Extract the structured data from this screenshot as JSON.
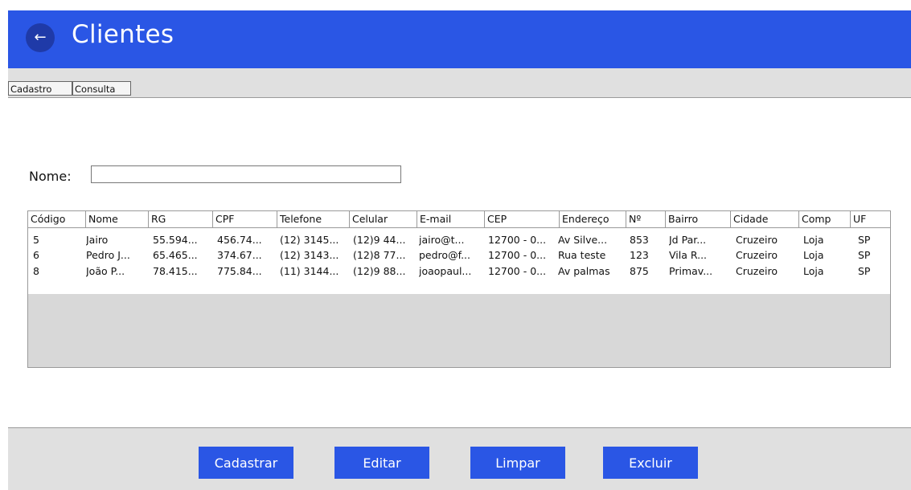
{
  "header": {
    "title": "Clientes",
    "back_icon": "arrow-left-icon",
    "color": "#2a56e5"
  },
  "tabs": [
    {
      "label": "Cadastro"
    },
    {
      "label": "Consulta"
    }
  ],
  "search": {
    "label": "Nome:",
    "value": ""
  },
  "table": {
    "columns": [
      "Código",
      "Nome",
      "RG",
      "CPF",
      "Telefone",
      "Celular",
      "E-mail",
      "CEP",
      "Endereço",
      "Nº",
      "Bairro",
      "Cidade",
      "Comp",
      "UF"
    ],
    "rows": [
      [
        "5",
        "Jairo",
        "55.594...",
        "456.74...",
        "(12) 3145...",
        "(12)9 44...",
        "jairo@t...",
        "12700 - 0...",
        "Av Silve...",
        "853",
        "Jd Par...",
        "Cruzeiro",
        "Loja",
        "SP"
      ],
      [
        "6",
        "Pedro J...",
        "65.465...",
        "374.67...",
        "(12) 3143...",
        "(12)8 77...",
        "pedro@f...",
        "12700 - 0...",
        "Rua teste",
        "123",
        "Vila R...",
        "Cruzeiro",
        "Loja",
        "SP"
      ],
      [
        "8",
        "João P...",
        "78.415...",
        "775.84...",
        "(11) 3144...",
        "(12)9 88...",
        "joaopaul...",
        "12700 - 0...",
        "Av palmas",
        "875",
        "Primav...",
        "Cruzeiro",
        "Loja",
        "SP"
      ]
    ]
  },
  "actions": {
    "cadastrar": "Cadastrar",
    "editar": "Editar",
    "limpar": "Limpar",
    "excluir": "Excluir"
  }
}
